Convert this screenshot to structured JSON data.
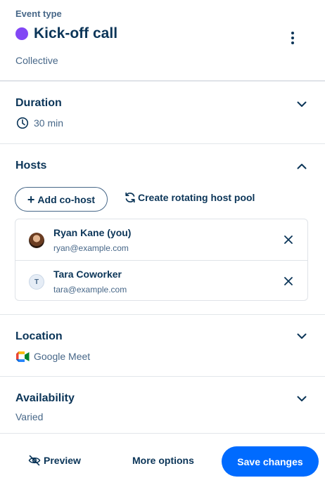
{
  "header": {
    "eyebrow": "Event type",
    "title": "Kick-off call",
    "subtitle": "Collective",
    "dot_color": "#8247f5",
    "menu_icon": "kebab-menu-icon"
  },
  "duration": {
    "title": "Duration",
    "value": "30 min",
    "icon": "clock-icon"
  },
  "hosts": {
    "title": "Hosts",
    "add_cohost_label": "Add co-host",
    "rotating_pool_label": "Create rotating host pool",
    "items": [
      {
        "name": "Ryan Kane (you)",
        "email": "ryan@example.com",
        "avatar": "photo"
      },
      {
        "name": "Tara Coworker",
        "email": "tara@example.com",
        "avatar": "T"
      }
    ]
  },
  "location": {
    "title": "Location",
    "value": "Google Meet",
    "icon": "google-meet-icon"
  },
  "availability": {
    "title": "Availability",
    "value": "Varied"
  },
  "footer": {
    "preview_label": "Preview",
    "more_options_label": "More options",
    "save_label": "Save changes"
  },
  "colors": {
    "primary": "#006bff",
    "text_dark": "#0b3558",
    "text_muted": "#476788",
    "accent_purple": "#8247f5"
  }
}
